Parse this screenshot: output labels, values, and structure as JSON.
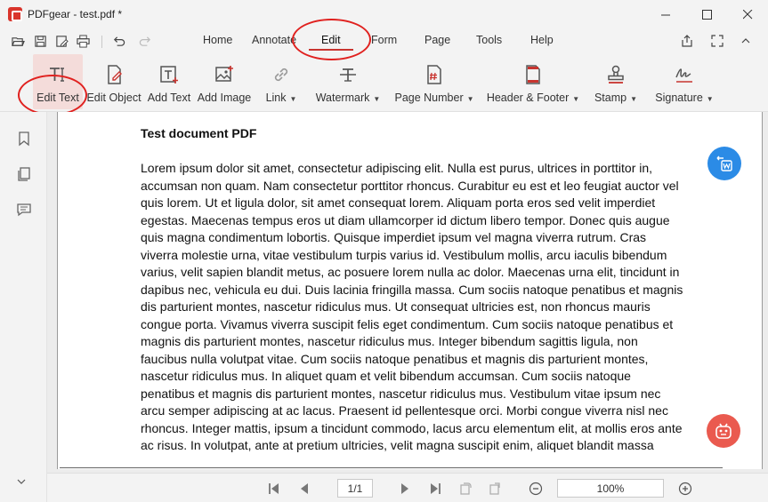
{
  "window": {
    "title": "PDFgear - test.pdf *",
    "controls": [
      "minimize",
      "maximize",
      "close"
    ]
  },
  "quick_access": [
    "open-icon",
    "save-icon",
    "save-as-icon",
    "print-icon",
    "undo-icon",
    "redo-icon"
  ],
  "menu": {
    "tabs": [
      {
        "label": "Home"
      },
      {
        "label": "Annotate"
      },
      {
        "label": "Edit"
      },
      {
        "label": "Form"
      },
      {
        "label": "Page"
      },
      {
        "label": "Tools"
      },
      {
        "label": "Help"
      }
    ],
    "active": "Edit"
  },
  "ribbon": {
    "items": [
      {
        "label": "Edit Text",
        "icon": "edit-text-icon",
        "dropdown": false
      },
      {
        "label": "Edit Object",
        "icon": "edit-object-icon",
        "dropdown": false
      },
      {
        "label": "Add Text",
        "icon": "add-text-icon",
        "dropdown": false
      },
      {
        "label": "Add Image",
        "icon": "add-image-icon",
        "dropdown": false
      },
      {
        "label": "Link",
        "icon": "link-icon",
        "dropdown": true
      },
      {
        "label": "Watermark",
        "icon": "watermark-icon",
        "dropdown": true
      },
      {
        "label": "Page Number",
        "icon": "page-number-icon",
        "dropdown": true
      },
      {
        "label": "Header & Footer",
        "icon": "header-footer-icon",
        "dropdown": true
      },
      {
        "label": "Stamp",
        "icon": "stamp-icon",
        "dropdown": true
      },
      {
        "label": "Signature",
        "icon": "signature-icon",
        "dropdown": true
      }
    ]
  },
  "document": {
    "title": "Test document PDF",
    "body": "Lorem ipsum dolor sit amet, consectetur adipiscing elit. Nulla est purus, ultrices in porttitor in, accumsan non quam. Nam consectetur porttitor rhoncus. Curabitur eu est et leo feugiat auctor vel quis lorem. Ut et ligula dolor, sit amet consequat lorem. Aliquam porta eros sed velit imperdiet egestas. Maecenas tempus eros ut diam ullamcorper id dictum libero tempor. Donec quis augue quis magna condimentum lobortis. Quisque imperdiet ipsum vel magna viverra rutrum. Cras viverra molestie urna, vitae vestibulum turpis varius id. Vestibulum mollis, arcu iaculis bibendum varius, velit sapien blandit metus, ac posuere lorem nulla ac dolor. Maecenas urna elit, tincidunt in dapibus nec, vehicula eu dui. Duis lacinia fringilla massa. Cum sociis natoque penatibus et magnis dis parturient montes, nascetur ridiculus mus. Ut consequat ultricies est, non rhoncus mauris congue porta. Vivamus viverra suscipit felis eget condimentum. Cum sociis natoque penatibus et magnis dis parturient montes, nascetur ridiculus mus. Integer bibendum sagittis ligula, non faucibus nulla volutpat vitae. Cum sociis natoque penatibus et magnis dis parturient montes, nascetur ridiculus mus. In aliquet quam et velit bibendum accumsan. Cum sociis natoque penatibus et magnis dis parturient montes, nascetur ridiculus mus. Vestibulum vitae ipsum nec arcu semper adipiscing at ac lacus. Praesent id pellentesque orci. Morbi congue viverra nisl nec rhoncus. Integer mattis, ipsum a tincidunt commodo, lacus arcu elementum elit, at mollis eros ante ac risus. In volutpat, ante at pretium ultricies, velit magna suscipit enim, aliquet blandit massa"
  },
  "floating": {
    "convert_icon": "pdf-to-word-icon",
    "assistant_icon": "ai-assistant-icon"
  },
  "pagination": {
    "current": "1",
    "separator": "/",
    "total": "1",
    "zoom": "100%"
  },
  "colors": {
    "accent": "#c8342f",
    "annotation": "#e0211f",
    "convert_button": "#2b8be6",
    "assistant_button": "#ea5a4f",
    "edit_text_highlight": "#f4dcda"
  }
}
